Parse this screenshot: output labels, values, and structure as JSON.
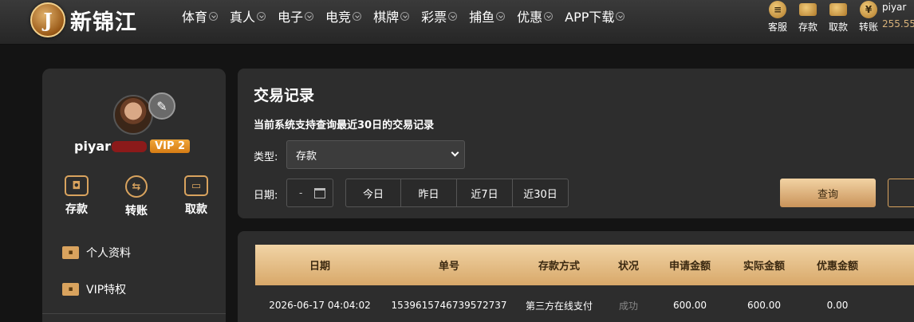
{
  "header": {
    "logo_letter": "J",
    "logo_text": "新锦江",
    "nav": [
      {
        "label": "体育"
      },
      {
        "label": "真人"
      },
      {
        "label": "电子"
      },
      {
        "label": "电竞"
      },
      {
        "label": "棋牌"
      },
      {
        "label": "彩票"
      },
      {
        "label": "捕鱼"
      },
      {
        "label": "优惠"
      },
      {
        "label": "APP下载"
      }
    ],
    "quick": [
      {
        "label": "客服",
        "icon": "customer-service-icon",
        "glyph": "≡"
      },
      {
        "label": "存款",
        "icon": "wallet-icon",
        "glyph": "▬"
      },
      {
        "label": "取款",
        "icon": "card-icon",
        "glyph": "▬"
      },
      {
        "label": "转账",
        "icon": "transfer-icon",
        "glyph": "¥"
      }
    ],
    "username": "piyar",
    "balance": "255.55"
  },
  "sidebar": {
    "username": "piyar",
    "vip": "VIP 2",
    "actions": [
      {
        "label": "存款",
        "icon": "wallet-icon",
        "glyph": "◘"
      },
      {
        "label": "转账",
        "icon": "transfer-icon",
        "glyph": "⇆"
      },
      {
        "label": "取款",
        "icon": "card-icon",
        "glyph": "▭"
      }
    ],
    "menu": [
      {
        "label": "个人资料",
        "icon": "profile-card-icon"
      },
      {
        "label": "VIP特权",
        "icon": "vip-card-icon"
      }
    ]
  },
  "filter": {
    "title": "交易记录",
    "subtitle": "当前系统支持查询最近30日的交易记录",
    "type_label": "类型:",
    "type_value": "存款",
    "date_label": "日期:",
    "date_value": "-",
    "quick_dates": [
      "今日",
      "昨日",
      "近7日",
      "近30日"
    ],
    "query_label": "查询"
  },
  "table": {
    "headers": [
      "日期",
      "单号",
      "存款方式",
      "状况",
      "申请金额",
      "实际金额",
      "优惠金额"
    ],
    "rows": [
      [
        "2026-06-17 04:04:02",
        "1539615746739572737",
        "第三方在线支付",
        "成功",
        "600.00",
        "600.00",
        "0.00"
      ]
    ]
  }
}
